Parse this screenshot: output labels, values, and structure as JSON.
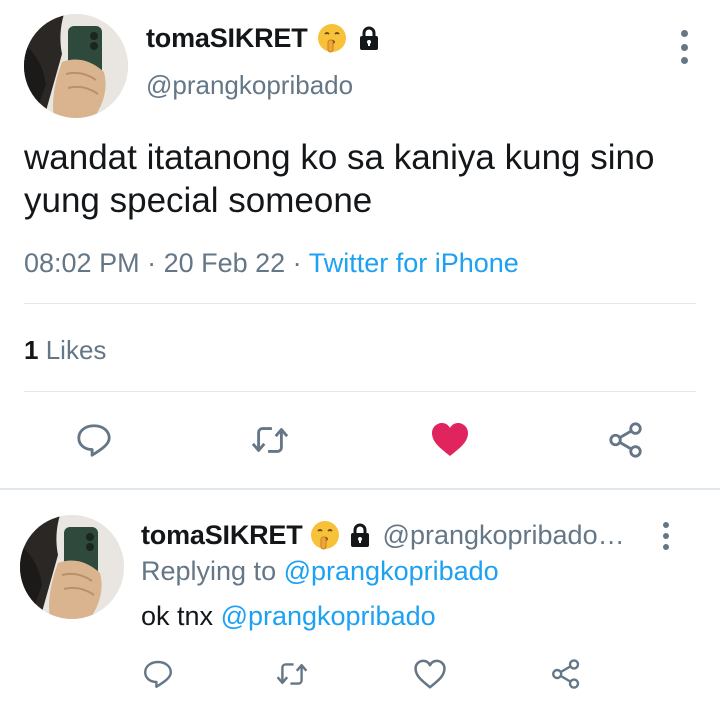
{
  "tweet": {
    "author": {
      "display_name": "tomaSIKRET",
      "handle": "@prangkopribado",
      "emoji_icon": "shushing-face-icon",
      "lock_icon": "lock-icon"
    },
    "text": "wandat itatanong ko sa kaniya kung sino yung special someone",
    "time": "08:02 PM",
    "separator": " · ",
    "date": "20 Feb 22",
    "source": "Twitter for iPhone",
    "likes_count": "1",
    "likes_label": "Likes",
    "liked": true
  },
  "reply": {
    "author": {
      "display_name": "tomaSIKRET",
      "handle": "@prangkopribado…"
    },
    "replying_to_label": "Replying to",
    "replying_to_handle": "@prangkopribado",
    "text": "ok tnx",
    "text_mention": "@prangkopribado",
    "liked": false
  },
  "colors": {
    "accent": "#1da1f2",
    "like": "#e0245e",
    "secondary_text": "#657786",
    "divider": "#e1e8ed"
  },
  "actions": [
    "reply-icon",
    "retweet-icon",
    "heart-icon",
    "share-icon"
  ]
}
